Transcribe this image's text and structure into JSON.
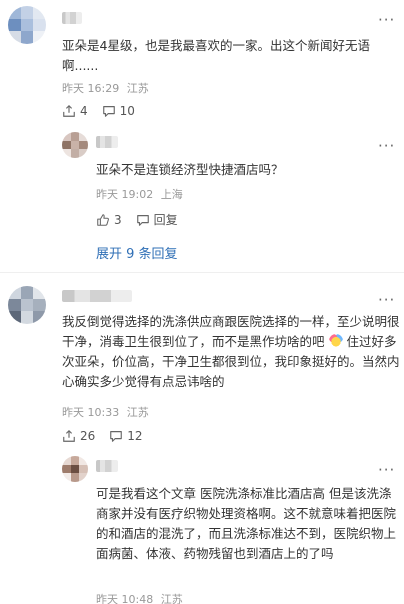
{
  "comments": [
    {
      "text": "亚朵是4星级，也是我最喜欢的一家。出这个新闻好无语啊......",
      "time": "昨天 16:29",
      "location": "江苏",
      "share_count": "4",
      "like_count": "10",
      "reply": {
        "text": "亚朵不是连锁经济型快捷酒店吗？",
        "time": "昨天 19:02",
        "location": "上海",
        "like_count": "3",
        "reply_label": "回复"
      },
      "expand_label": "展开 9 条回复"
    },
    {
      "text_part1": "我反倒觉得选择的洗涤供应商跟医院选择的一样，至少说明很干净，消毒卫生很到位了，而不是黑作坊啥的吧",
      "text_part2": "住过好多次亚朵，价位高，干净卫生都很到位，我印象挺好的。当然内心确实多少觉得有点忌讳啥的",
      "emoji": "party-emoji",
      "time": "昨天 10:33",
      "location": "江苏",
      "share_count": "26",
      "like_count": "12",
      "reply": {
        "text": "可是我看这个文章 医院洗涤标准比酒店高 但是该洗涤商家并没有医疗织物处理资格啊。这不就意味着把医院的和酒店的混洗了，而且洗涤标准达不到，医院织物上面病菌、体液、药物残留也到酒店上的了吗",
        "time": "昨天 10:48",
        "location": "江苏"
      }
    }
  ],
  "icons": {
    "more": "more-horizontal-icon",
    "share": "share-icon",
    "comment": "comment-icon",
    "like": "like-icon"
  },
  "colors": {
    "link": "#2f6fb6",
    "meta": "#999999",
    "text": "#333333"
  }
}
